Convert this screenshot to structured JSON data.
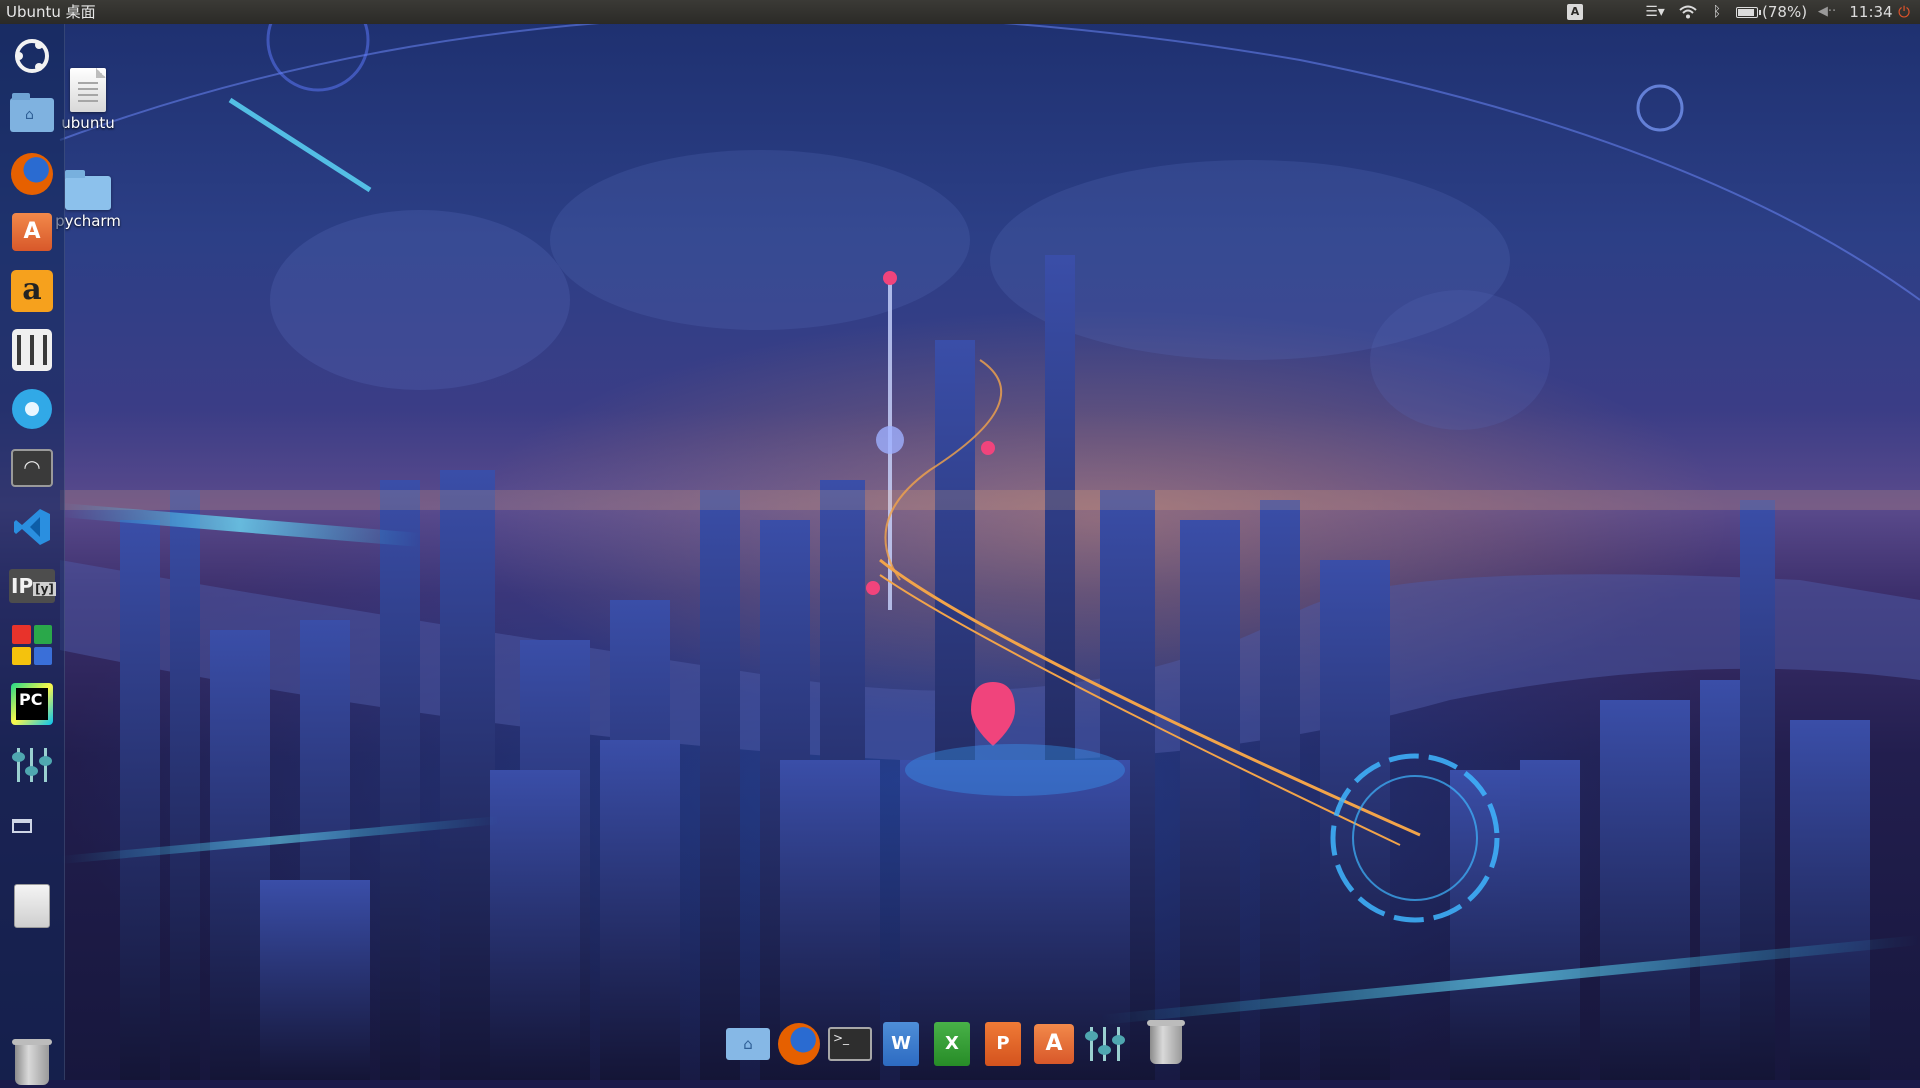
{
  "topbar": {
    "title": "Ubuntu 桌面",
    "keyboard_indicator": "A",
    "battery_label": "(78%)",
    "battery_level": 0.78,
    "clock": "11:34"
  },
  "launcher": {
    "items": [
      {
        "name": "dash-home",
        "icon": "ubuntu-logo-icon"
      },
      {
        "name": "home-folder",
        "icon": "home-folder-icon"
      },
      {
        "name": "firefox",
        "icon": "firefox-icon"
      },
      {
        "name": "ubuntu-software",
        "icon": "shopping-bag-icon",
        "glyph": "A"
      },
      {
        "name": "amazon",
        "icon": "amazon-icon",
        "glyph": "a"
      },
      {
        "name": "sound-mixer",
        "icon": "mixer-icon"
      },
      {
        "name": "system-settings",
        "icon": "gear-icon"
      },
      {
        "name": "system-monitor",
        "icon": "gauge-icon"
      },
      {
        "name": "vscode",
        "icon": "vscode-icon"
      },
      {
        "name": "ipython",
        "icon": "ipython-icon",
        "glyph": "IP",
        "glyph_small": "[y]"
      },
      {
        "name": "app-mosaic",
        "icon": "mosaic-icon"
      },
      {
        "name": "pycharm",
        "icon": "pycharm-icon",
        "glyph": "PC"
      },
      {
        "name": "equalizer",
        "icon": "equalizer-icon"
      },
      {
        "name": "workspaces",
        "icon": "window-icon"
      },
      {
        "name": "drive",
        "icon": "drive-icon"
      },
      {
        "name": "trash",
        "icon": "trash-icon"
      }
    ]
  },
  "desktop": {
    "icons": [
      {
        "label": "ubuntu",
        "icon": "document-icon"
      },
      {
        "label": "pycharm",
        "icon": "folder-icon"
      }
    ]
  },
  "dock": {
    "items": [
      {
        "name": "home-folder",
        "icon": "home-folder-icon"
      },
      {
        "name": "firefox",
        "icon": "firefox-icon"
      },
      {
        "name": "terminal",
        "icon": "terminal-icon",
        "glyph": ">_"
      },
      {
        "name": "writer",
        "icon": "writer-icon",
        "glyph": "W"
      },
      {
        "name": "calc",
        "icon": "calc-icon",
        "glyph": "X"
      },
      {
        "name": "impress",
        "icon": "impress-icon",
        "glyph": "P"
      },
      {
        "name": "ubuntu-software",
        "icon": "shopping-bag-icon",
        "glyph": "A"
      },
      {
        "name": "equalizer",
        "icon": "equalizer-icon"
      },
      {
        "name": "trash",
        "icon": "trash-icon"
      }
    ]
  },
  "colors": {
    "panel": "#2b2a27",
    "launcher": "#14285a",
    "accent": "#e0532a",
    "wallpaper_top": "#1d2f6e",
    "wallpaper_horizon": "#5a4a8c",
    "wallpaper_bottom": "#17173d"
  }
}
